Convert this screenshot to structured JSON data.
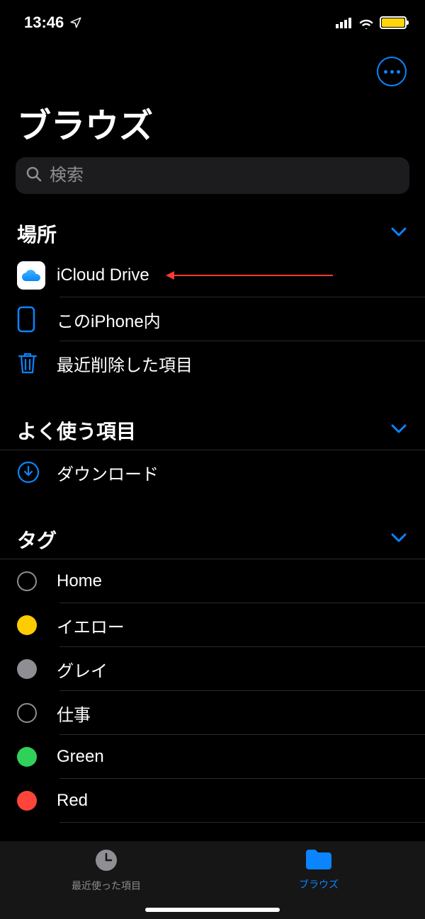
{
  "status": {
    "time": "13:46"
  },
  "header": {
    "title": "ブラウズ"
  },
  "search": {
    "placeholder": "検索"
  },
  "sections": {
    "locations": {
      "title": "場所",
      "items": [
        {
          "label": "iCloud Drive"
        },
        {
          "label": "このiPhone内"
        },
        {
          "label": "最近削除した項目"
        }
      ]
    },
    "favorites": {
      "title": "よく使う項目",
      "items": [
        {
          "label": "ダウンロード"
        }
      ]
    },
    "tags": {
      "title": "タグ",
      "items": [
        {
          "label": "Home",
          "color": "transparent",
          "hollow": true
        },
        {
          "label": "イエロー",
          "color": "#ffcc00",
          "hollow": false
        },
        {
          "label": "グレイ",
          "color": "#8e8e93",
          "hollow": false
        },
        {
          "label": "仕事",
          "color": "transparent",
          "hollow": true
        },
        {
          "label": "Green",
          "color": "#30d158",
          "hollow": false
        },
        {
          "label": "Red",
          "color": "#ff453a",
          "hollow": false
        }
      ]
    }
  },
  "tabs": {
    "recents": "最近使った項目",
    "browse": "ブラウズ"
  }
}
